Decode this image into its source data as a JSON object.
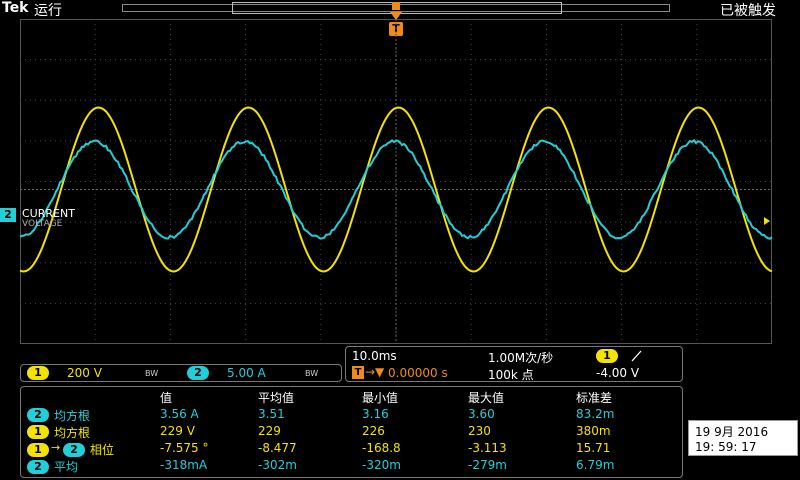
{
  "top": {
    "brand": "Tek",
    "status": "运行",
    "trigger_state": "已被触发",
    "trigger_label": "T"
  },
  "waveform": {
    "ch2_label": "CURRENT",
    "ch1_label": "VOLTAGE",
    "colors": {
      "ch1": "#f4e200",
      "ch2": "#22cfd8"
    }
  },
  "channels": {
    "ch1": {
      "badge": "1",
      "scale": "200 V",
      "bw": "BW"
    },
    "ch2": {
      "badge": "2",
      "scale": "5.00 A",
      "bw": "BW"
    }
  },
  "timebase": {
    "scale": "10.0ms",
    "sample_rate": "1.00M次/秒",
    "trig_pos": "0.00000 s",
    "record_len": "100k 点",
    "trig_ch": "1",
    "slope_icon": "rising-slope-icon",
    "trig_level": "-4.00 V"
  },
  "measurements": {
    "headers": [
      "值",
      "平均值",
      "最小值",
      "最大值",
      "标准差"
    ],
    "rows": [
      {
        "badge": "2",
        "name": "均方根",
        "values": [
          "3.56 A",
          "3.51",
          "3.16",
          "3.60",
          "83.2m"
        ]
      },
      {
        "badge": "1",
        "name": "均方根",
        "values": [
          "229 V",
          "229",
          "226",
          "230",
          "380m"
        ]
      },
      {
        "badge": "1",
        "badge2": "2",
        "name": "相位",
        "values": [
          "-7.575 °",
          "-8.477",
          "-168.8",
          "-3.113",
          "15.71"
        ]
      },
      {
        "badge": "2",
        "name": "平均",
        "values": [
          "-318mA",
          "-302m",
          "-320m",
          "-279m",
          "6.79m"
        ]
      }
    ]
  },
  "datetime": {
    "date": "19 9月  2016",
    "time": "19: 59: 17"
  }
}
